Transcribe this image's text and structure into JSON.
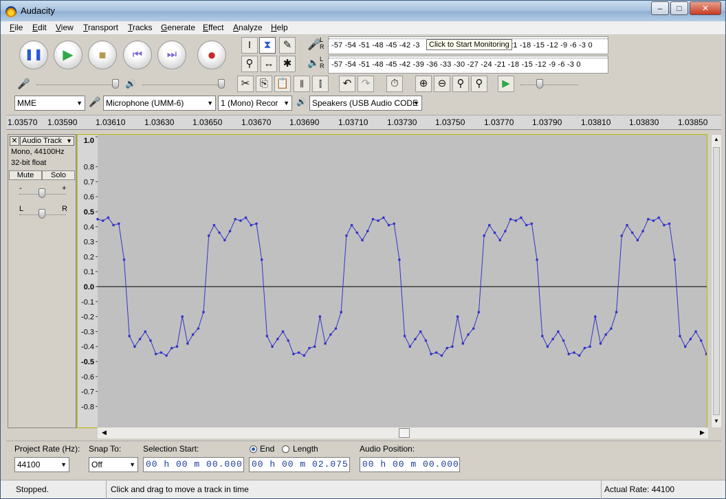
{
  "window": {
    "title": "Audacity"
  },
  "menu": [
    "File",
    "Edit",
    "View",
    "Transport",
    "Tracks",
    "Generate",
    "Effect",
    "Analyze",
    "Help"
  ],
  "meters": {
    "record_scale": "-57 -54 -51 -48 -45 -42 -3",
    "record_scale_tail": "21 -18 -15 -12 -9 -6 -3 0",
    "play_scale": "-57 -54 -51 -48 -45 -42 -39 -36 -33 -30 -27 -24 -21 -18 -15 -12 -9 -6 -3 0",
    "tooltip": "Click to Start Monitoring"
  },
  "devices": {
    "host": "MME",
    "input": "Microphone (UMM-6)",
    "channels": "1 (Mono) Recor",
    "output": "Speakers (USB Audio CODE"
  },
  "ruler": {
    "labels": [
      "1.03570",
      "1.03590",
      "1.03610",
      "1.03630",
      "1.03650",
      "1.03670",
      "1.03690",
      "1.03710",
      "1.03730",
      "1.03750",
      "1.03770",
      "1.03790",
      "1.03810",
      "1.03830",
      "1.03850"
    ]
  },
  "track": {
    "name": "Audio Track",
    "format": "Mono, 44100Hz",
    "bitdepth": "32-bit float",
    "mute": "Mute",
    "solo": "Solo",
    "gain_minus": "-",
    "gain_plus": "+",
    "pan_left": "L",
    "pan_right": "R"
  },
  "waveform": {
    "y_labels": [
      "1.0",
      "0.8",
      "0.7",
      "0.6",
      "0.5",
      "0.4",
      "0.3",
      "0.2",
      "0.1",
      "0.0",
      "-0.1",
      "-0.2",
      "-0.3",
      "-0.4",
      "-0.5",
      "-0.6",
      "-0.7",
      "-0.8"
    ],
    "color": "#3232c8"
  },
  "selection": {
    "project_rate_label": "Project Rate (Hz):",
    "project_rate": "44100",
    "snap_label": "Snap To:",
    "snap_value": "Off",
    "start_label": "Selection Start:",
    "start_value": "00 h 00 m 00.000 s",
    "end_label": "End",
    "length_label": "Length",
    "end_value": "00 h 00 m 02.075 s",
    "position_label": "Audio Position:",
    "position_value": "00 h 00 m 00.000 s"
  },
  "status": {
    "state": "Stopped.",
    "hint": "Click and drag to move a track in time",
    "rate": "Actual Rate: 44100"
  }
}
